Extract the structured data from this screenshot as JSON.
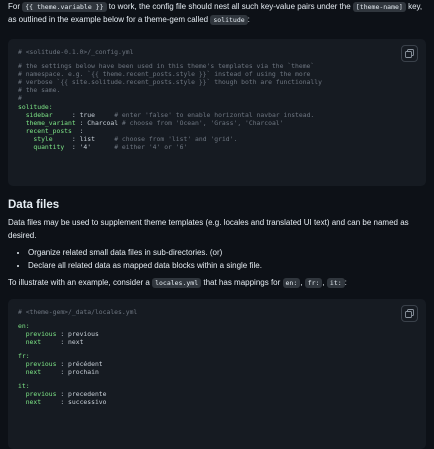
{
  "intro": {
    "t1": "For ",
    "code1": "{{ theme.variable }}",
    "t2": " to work, the config file should nest all such key-value pairs under the ",
    "code2": "[theme-name]",
    "t3": " key,",
    "t4": "as outlined in the example below for a theme-gem called ",
    "code3": "solitude",
    "t5": ":"
  },
  "config_block": {
    "filename": "# <solitude-0.1.0>/_config.yml",
    "comments": [
      "# the settings below have been used in this theme's templates via the `theme`",
      "# namespace. e.g. `{{ theme.recent_posts.style }}` instead of using the more",
      "# verbose `{{ site.solitude.recent_posts.style }}` though both are functionally",
      "# the same.",
      "#"
    ],
    "root_key": "solitude:",
    "rows": [
      {
        "key": "  sidebar",
        "sep": "     : ",
        "val": "true   ",
        "comment": "  # enter 'false' to enable horizontal navbar instead."
      },
      {
        "key": "  theme_variant",
        "sep": " : ",
        "val": "Charcoal",
        "comment": " # choose from 'Ocean', 'Grass', 'Charcoal'"
      },
      {
        "key": "  recent_posts",
        "sep": "  :",
        "val": "",
        "comment": ""
      },
      {
        "key": "    style",
        "sep": "     : ",
        "val": "list   ",
        "comment": "  # choose from 'list' and 'grid'."
      },
      {
        "key": "    quantity",
        "sep": "  : ",
        "val": "'4'    ",
        "comment": "  # either '4' or '6'"
      }
    ]
  },
  "data_files": {
    "heading": "Data files",
    "para": "Data files may be used to supplement theme templates (e.g. locales and translated UI text) and can be named as desired.",
    "bullets": [
      "Organize related small data files in sub-directories. (or)",
      "Declare all related data as mapped data blocks within a single file."
    ],
    "illus_t1": "To illustrate with an example, consider a ",
    "illus_code1": "locales.yml",
    "illus_t2": " that has mappings for ",
    "illus_code2": "en:",
    "illus_t3": ", ",
    "illus_code3": "fr:",
    "illus_t4": ", ",
    "illus_code4": "it:",
    "illus_t5": ":"
  },
  "locales_block": {
    "filename": "# <theme-gem>/_data/locales.yml",
    "groups": [
      {
        "lang": "en:",
        "rows": [
          {
            "key": "  previous",
            "sep": " : ",
            "val": "previous"
          },
          {
            "key": "  next    ",
            "sep": " : ",
            "val": "next"
          }
        ]
      },
      {
        "lang": "fr:",
        "rows": [
          {
            "key": "  previous",
            "sep": " : ",
            "val": "précédent"
          },
          {
            "key": "  next    ",
            "sep": " : ",
            "val": "prochain"
          }
        ]
      },
      {
        "lang": "it:",
        "rows": [
          {
            "key": "  previous",
            "sep": " : ",
            "val": "precedente"
          },
          {
            "key": "  next    ",
            "sep": " : ",
            "val": "successivo"
          }
        ]
      }
    ]
  },
  "icons": {
    "copy": "copy-icon"
  }
}
